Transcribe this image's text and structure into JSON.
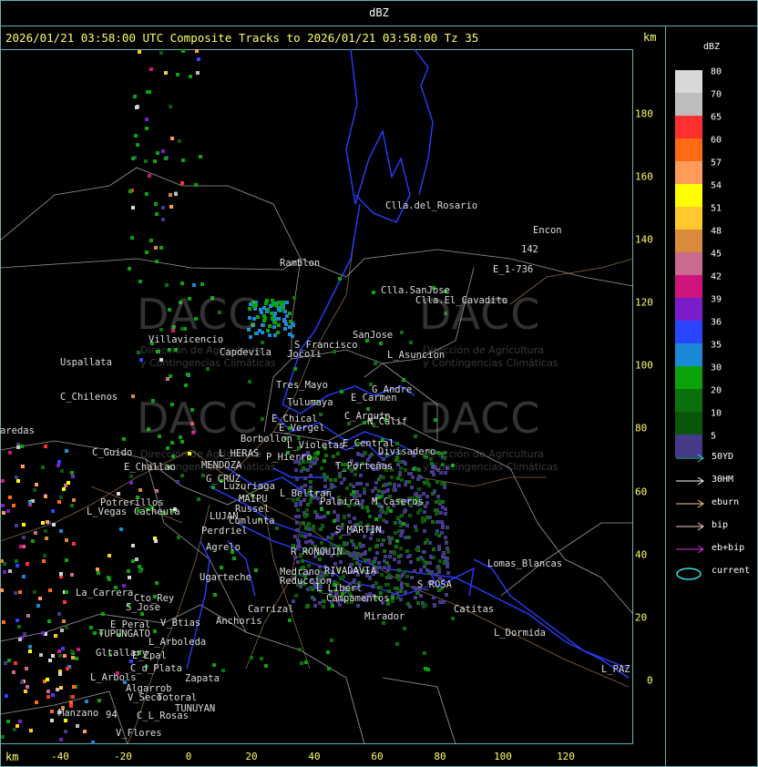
{
  "window_title": "dBZ",
  "header": "2026/01/21 03:58:00 UTC Composite Tracks to 2026/01/21 03:58:00 Tz 35",
  "unit_top": "km",
  "unit_bottom": "km",
  "x_ticks": [
    "-40",
    "-20",
    "0",
    "20",
    "40",
    "60",
    "80",
    "100",
    "120"
  ],
  "y_ticks": [
    "180",
    "160",
    "140",
    "120",
    "100",
    "80",
    "60",
    "40",
    "20",
    "0"
  ],
  "legend": {
    "title": "dBZ",
    "levels": [
      {
        "label": "80",
        "color": "#d8d8d8"
      },
      {
        "label": "70",
        "color": "#bdbdbd"
      },
      {
        "label": "65",
        "color": "#ff3030"
      },
      {
        "label": "60",
        "color": "#ff6a12"
      },
      {
        "label": "57",
        "color": "#ff9a5a"
      },
      {
        "label": "54",
        "color": "#ffff00"
      },
      {
        "label": "51",
        "color": "#ffc82e"
      },
      {
        "label": "48",
        "color": "#d98a3a"
      },
      {
        "label": "45",
        "color": "#c86b8f"
      },
      {
        "label": "42",
        "color": "#d0147e"
      },
      {
        "label": "39",
        "color": "#7a1cc8"
      },
      {
        "label": "36",
        "color": "#2a44ff"
      },
      {
        "label": "35",
        "color": "#1a8ad8"
      },
      {
        "label": "30",
        "color": "#0aa30a"
      },
      {
        "label": "20",
        "color": "#0c700c"
      },
      {
        "label": "10",
        "color": "#0a560a"
      },
      {
        "label": "5",
        "color": "#453a8a"
      }
    ],
    "tracks": [
      {
        "label": "50YD",
        "color": "#33cccc"
      },
      {
        "label": "30HM",
        "color": "#ffffff"
      },
      {
        "label": "eburn",
        "color": "#ffcc88"
      },
      {
        "label": "bip",
        "color": "#ffcccc"
      },
      {
        "label": "eb+bip",
        "color": "#dd33dd"
      },
      {
        "label": "current",
        "color": "#33dddd"
      }
    ]
  },
  "watermark": {
    "brand": "DACC",
    "subtitle_1": "Dirección de Agricultura",
    "subtitle_2": "y Contingencias Climáticas"
  },
  "places": [
    {
      "name": "Clla.del_Rosario"
    },
    {
      "name": "Encon"
    },
    {
      "name": "142"
    },
    {
      "name": "E_1-736"
    },
    {
      "name": "Ramblon"
    },
    {
      "name": "Clla.SanJose"
    },
    {
      "name": "Clla.El_Cavadito"
    },
    {
      "name": "Villavicencio"
    },
    {
      "name": "Capdevila"
    },
    {
      "name": "S_Francisco"
    },
    {
      "name": "SanJose"
    },
    {
      "name": "L_Asuncion"
    },
    {
      "name": "Jocoli"
    },
    {
      "name": "Uspallata"
    },
    {
      "name": "Tres_Mayo"
    },
    {
      "name": "G_Andre"
    },
    {
      "name": "E_Carmen"
    },
    {
      "name": "C_Chilenos"
    },
    {
      "name": "Tulumaya"
    },
    {
      "name": "C_Arguin"
    },
    {
      "name": "N_Calif"
    },
    {
      "name": "E_Chical"
    },
    {
      "name": "E_Vergel"
    },
    {
      "name": "aredas"
    },
    {
      "name": "Borbollon"
    },
    {
      "name": "L_Violetas"
    },
    {
      "name": "E_Central"
    },
    {
      "name": "Divisadero"
    },
    {
      "name": "C_Guido"
    },
    {
      "name": "L_HERAS"
    },
    {
      "name": "P_Hierro"
    },
    {
      "name": "E_Challao"
    },
    {
      "name": "MENDOZA"
    },
    {
      "name": "T_Porteñas"
    },
    {
      "name": "G_CRUZ"
    },
    {
      "name": "Luzuriaga"
    },
    {
      "name": "L_Beltran"
    },
    {
      "name": "Palmira"
    },
    {
      "name": "M_Caseros"
    },
    {
      "name": "Potrerillos"
    },
    {
      "name": "MAIPU"
    },
    {
      "name": "L_Vegas"
    },
    {
      "name": "Cacheuta"
    },
    {
      "name": "Russel"
    },
    {
      "name": "LUJAN"
    },
    {
      "name": "Cumlunta"
    },
    {
      "name": "Perdriel"
    },
    {
      "name": "S_MARTIN"
    },
    {
      "name": "Agrelo"
    },
    {
      "name": "R_RONQUIN"
    },
    {
      "name": "Lomas_Blancas"
    },
    {
      "name": "Ugarteche"
    },
    {
      "name": "Medrano"
    },
    {
      "name": "Reduccion"
    },
    {
      "name": "RIVADAVIA"
    },
    {
      "name": "L_Libert"
    },
    {
      "name": "S_ROSA"
    },
    {
      "name": "La_Carrera"
    },
    {
      "name": "Cto_Rey"
    },
    {
      "name": "S_Jose"
    },
    {
      "name": "Campamentos"
    },
    {
      "name": "Catitas"
    },
    {
      "name": "Carrizal"
    },
    {
      "name": "Mirador"
    },
    {
      "name": "E_Peral"
    },
    {
      "name": "V_Btias"
    },
    {
      "name": "Anchoris"
    },
    {
      "name": "TUPUNGATO"
    },
    {
      "name": "L_Dormida"
    },
    {
      "name": "L_Arboleda"
    },
    {
      "name": "Gltallary"
    },
    {
      "name": "E_Zpal"
    },
    {
      "name": "C_d_Plata"
    },
    {
      "name": "L_PAZ"
    },
    {
      "name": "L_Arbols"
    },
    {
      "name": "Zapata"
    },
    {
      "name": "Algarrob"
    },
    {
      "name": "V_Seco"
    },
    {
      "name": "Totoral"
    },
    {
      "name": "TUNUYAN"
    },
    {
      "name": "Manzano"
    },
    {
      "name": "94"
    },
    {
      "name": "C_L_Rosas"
    },
    {
      "name": "V_Flores"
    }
  ]
}
